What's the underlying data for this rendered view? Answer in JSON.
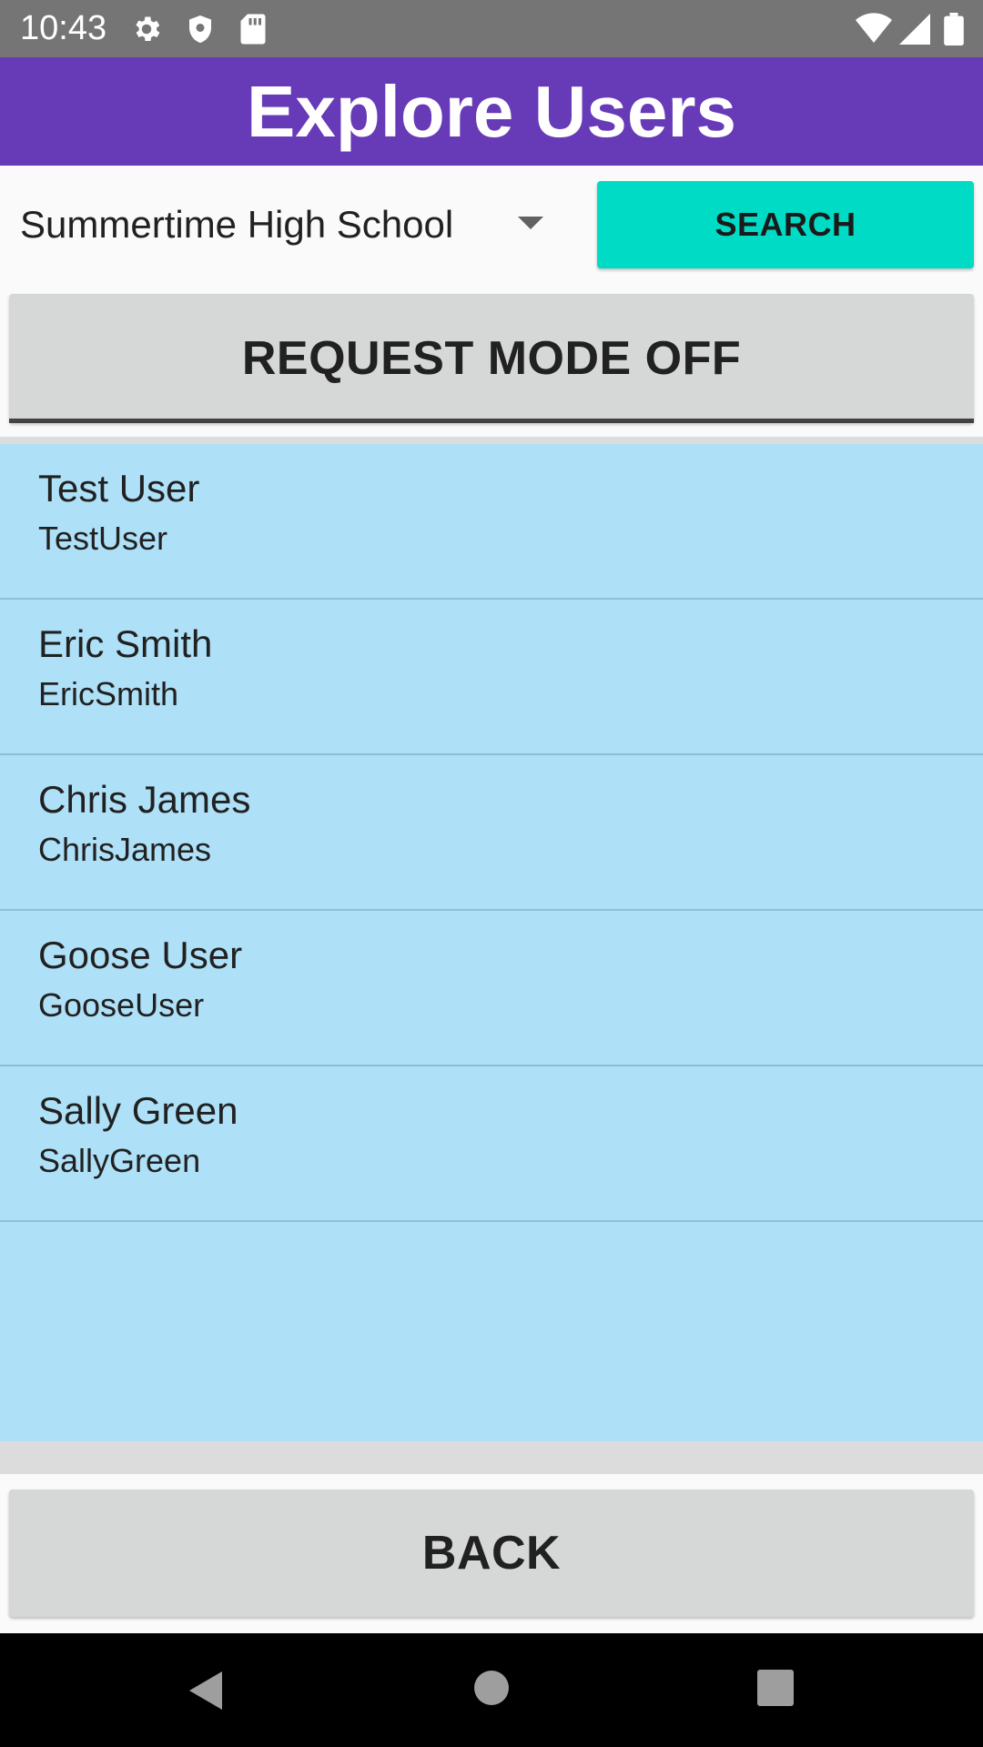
{
  "status_bar": {
    "time": "10:43",
    "left_icons": [
      "gear-icon",
      "shield-icon",
      "sd-card-icon"
    ],
    "right_icons": [
      "wifi-icon",
      "signal-icon",
      "battery-icon"
    ],
    "background_color": "#757575"
  },
  "app_bar": {
    "title": "Explore Users",
    "background_color": "#673ab7"
  },
  "filter": {
    "school_selected": "Summertime High School",
    "search_label": "SEARCH",
    "search_color": "#00dbc5"
  },
  "request_mode": {
    "label": "REQUEST MODE OFF"
  },
  "users": [
    {
      "name": "Test User",
      "username": "TestUser"
    },
    {
      "name": "Eric Smith",
      "username": "EricSmith"
    },
    {
      "name": "Chris James",
      "username": "ChrisJames"
    },
    {
      "name": "Goose User",
      "username": "GooseUser"
    },
    {
      "name": "Sally Green",
      "username": "SallyGreen"
    }
  ],
  "list_background_color": "#aee0f7",
  "back": {
    "label": "BACK"
  },
  "nav_bar": {
    "icons": [
      "back-triangle-icon",
      "home-circle-icon",
      "recents-square-icon"
    ]
  }
}
